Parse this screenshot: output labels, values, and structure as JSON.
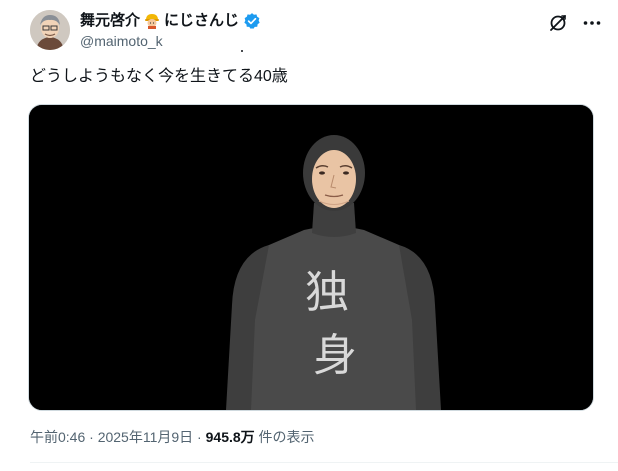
{
  "author": {
    "display_name": "舞元啓介",
    "name_suffix": "にじさんじ",
    "handle": "@maimoto_k",
    "verified": true
  },
  "post": {
    "text": "どうしようもなく今を生きてる40歳",
    "media": {
      "chest_text_line1": "独",
      "chest_text_line2": "身"
    }
  },
  "meta": {
    "time": "午前0:46",
    "sep1": " · ",
    "date": "2025年11月9日",
    "sep2": " · ",
    "views": "945.8万",
    "views_label": " 件の表示"
  },
  "icons": {
    "top_right": "grok-icon",
    "more": "more-icon",
    "verified": "verified-badge-icon",
    "badge": "construction-worker-emoji"
  },
  "colors": {
    "verified_blue": "#1d9bf0",
    "secondary_text": "#536471",
    "primary_text": "#0f1419",
    "media_bg": "#000000"
  }
}
